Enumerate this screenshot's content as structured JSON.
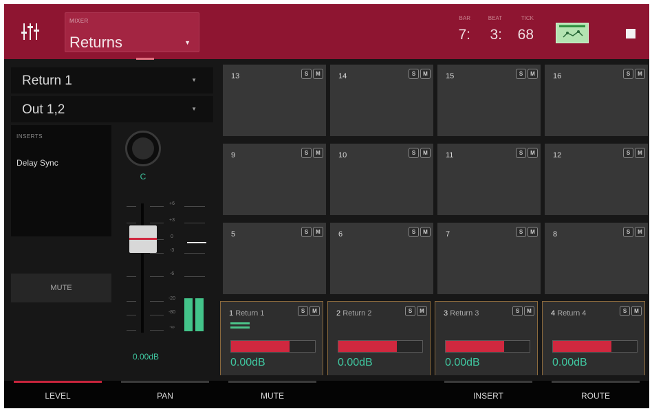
{
  "header": {
    "mixer_caption": "MIXER",
    "mixer_value": "Returns",
    "bars_caption": "BAR",
    "beats_caption": "BEAT",
    "ticks_caption": "TICK",
    "bars": "7:",
    "beats": "3:",
    "ticks": "68",
    "accent_color": "#8e1531"
  },
  "left_panel": {
    "channel_select": "Return 1",
    "output_select": "Out 1,2",
    "inserts_caption": "INSERTS",
    "insert_1": "Delay Sync",
    "pan_value": "C",
    "mute_label": "MUTE",
    "level_value": "0.00dB",
    "scale": [
      "+6",
      "+3",
      "0",
      "-3",
      "-6",
      "-20",
      "-80",
      "-∞"
    ]
  },
  "pads": [
    {
      "num": "13"
    },
    {
      "num": "14"
    },
    {
      "num": "15"
    },
    {
      "num": "16"
    },
    {
      "num": "9"
    },
    {
      "num": "10"
    },
    {
      "num": "11"
    },
    {
      "num": "12"
    },
    {
      "num": "5"
    },
    {
      "num": "6"
    },
    {
      "num": "7"
    },
    {
      "num": "8"
    }
  ],
  "returns": [
    {
      "num": "1",
      "name": "Return 1",
      "db": "0.00dB",
      "level": 0.7
    },
    {
      "num": "2",
      "name": "Return 2",
      "db": "0.00dB",
      "level": 0.7
    },
    {
      "num": "3",
      "name": "Return 3",
      "db": "0.00dB",
      "level": 0.7
    },
    {
      "num": "4",
      "name": "Return 4",
      "db": "0.00dB",
      "level": 0.7
    }
  ],
  "solo_label": "S",
  "mute_short": "M",
  "footer": {
    "tab_level": "LEVEL",
    "tab_pan": "PAN",
    "tab_mute": "MUTE",
    "tab_insert": "INSERT",
    "tab_route": "ROUTE"
  }
}
